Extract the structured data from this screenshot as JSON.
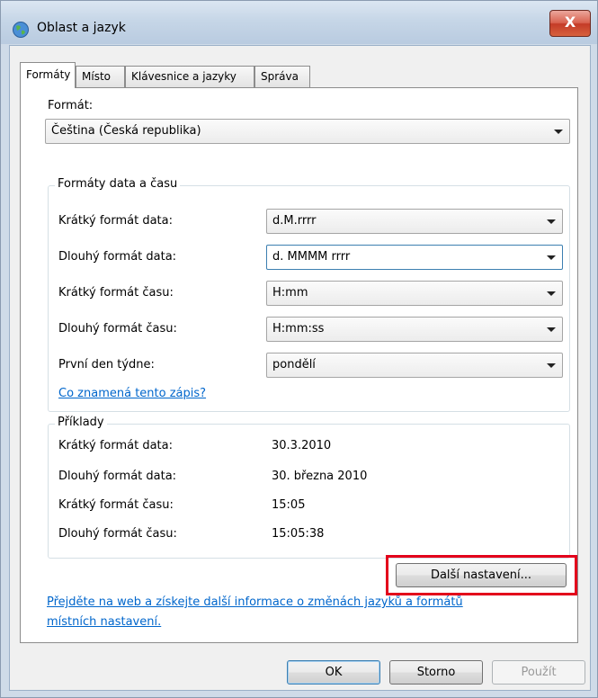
{
  "window": {
    "title": "Oblast a jazyk",
    "close_glyph": "X"
  },
  "tabs": [
    {
      "label": "Formáty",
      "active": true
    },
    {
      "label": "Místo",
      "active": false
    },
    {
      "label": "Klávesnice a jazyky",
      "active": false
    },
    {
      "label": "Správa",
      "active": false
    }
  ],
  "format": {
    "label": "Formát:",
    "value": "Čeština (Česká republika)"
  },
  "datetime_group": {
    "title": "Formáty data a času",
    "rows": [
      {
        "label": "Krátký formát data:",
        "value": "d.M.rrrr"
      },
      {
        "label": "Dlouhý formát data:",
        "value": "d. MMMM rrrr"
      },
      {
        "label": "Krátký formát času:",
        "value": "H:mm"
      },
      {
        "label": "Dlouhý formát času:",
        "value": "H:mm:ss"
      },
      {
        "label": "První den týdne:",
        "value": "pondělí"
      }
    ],
    "help_link": "Co znamená tento zápis?"
  },
  "examples_group": {
    "title": "Příklady",
    "rows": [
      {
        "label": "Krátký formát data:",
        "value": "30.3.2010"
      },
      {
        "label": "Dlouhý formát data:",
        "value": "30. března 2010"
      },
      {
        "label": "Krátký formát času:",
        "value": "15:05"
      },
      {
        "label": "Dlouhý formát času:",
        "value": "15:05:38"
      }
    ]
  },
  "more_settings_button": "Další nastavení...",
  "web_link": {
    "line1": "Přejděte na web a získejte další informace o změnách jazyků a formátů",
    "line2": "místních nastavení."
  },
  "footer_buttons": {
    "ok": "OK",
    "cancel": "Storno",
    "apply": "Použít"
  },
  "colors": {
    "highlight": "#e3001b",
    "link": "#0066cc",
    "close_button": "#c43b27"
  }
}
